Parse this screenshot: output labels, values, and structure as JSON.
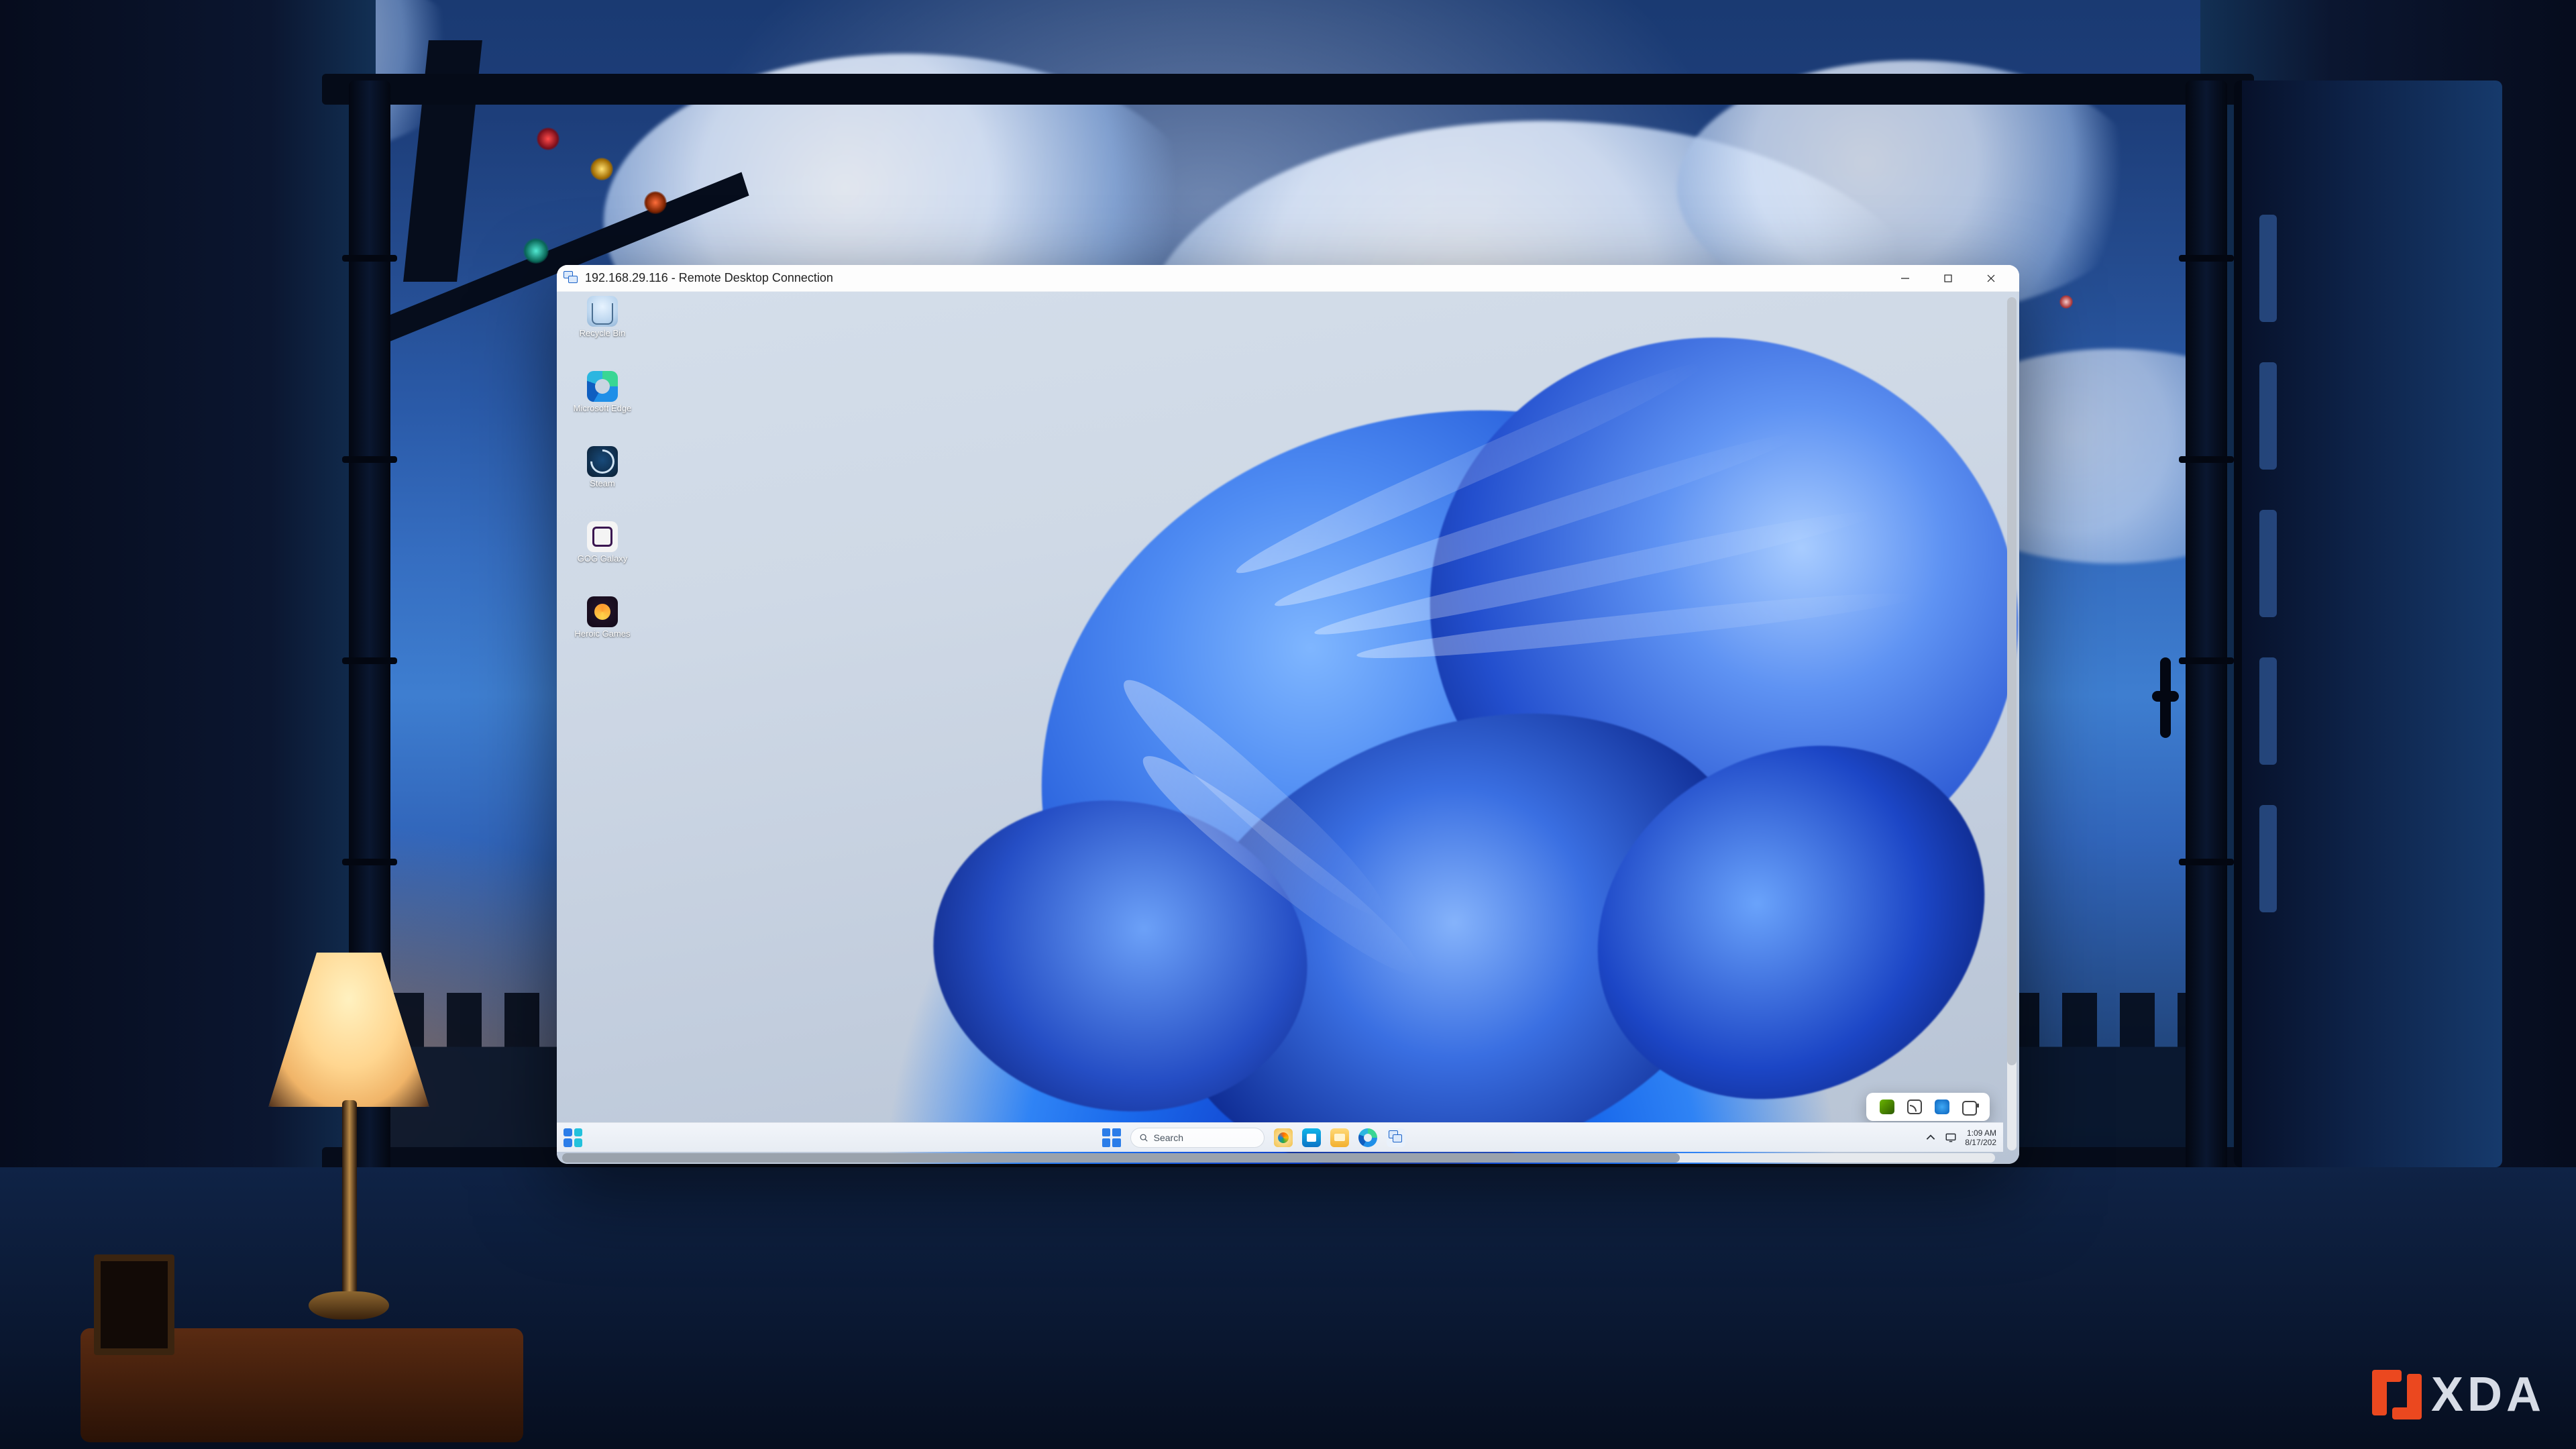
{
  "watermark": {
    "text": "XDA"
  },
  "window": {
    "title": "192.168.29.116 - Remote Desktop Connection",
    "controls": {
      "minimize": "Minimize",
      "maximize": "Maximize",
      "close": "Close"
    }
  },
  "remote": {
    "desktop_icons": [
      {
        "id": "recycle-bin",
        "label": "Recycle Bin"
      },
      {
        "id": "edge",
        "label": "Microsoft Edge"
      },
      {
        "id": "steam",
        "label": "Steam"
      },
      {
        "id": "gog",
        "label": "GOG Galaxy"
      },
      {
        "id": "heroic",
        "label": "Heroic Games"
      }
    ],
    "tray_card_icons": [
      "nvidia",
      "cast",
      "onedrive",
      "battery"
    ],
    "taskbar": {
      "widgets": "Widgets",
      "start": "Start",
      "search_placeholder": "Search",
      "pinned": [
        "copilot",
        "microsoft-store",
        "file-explorer",
        "edge",
        "remote-desktop"
      ],
      "systray": {
        "overflow": "Show hidden icons",
        "network": "Network",
        "clock_time": "1:09 AM",
        "clock_date": "8/17/202"
      }
    }
  }
}
